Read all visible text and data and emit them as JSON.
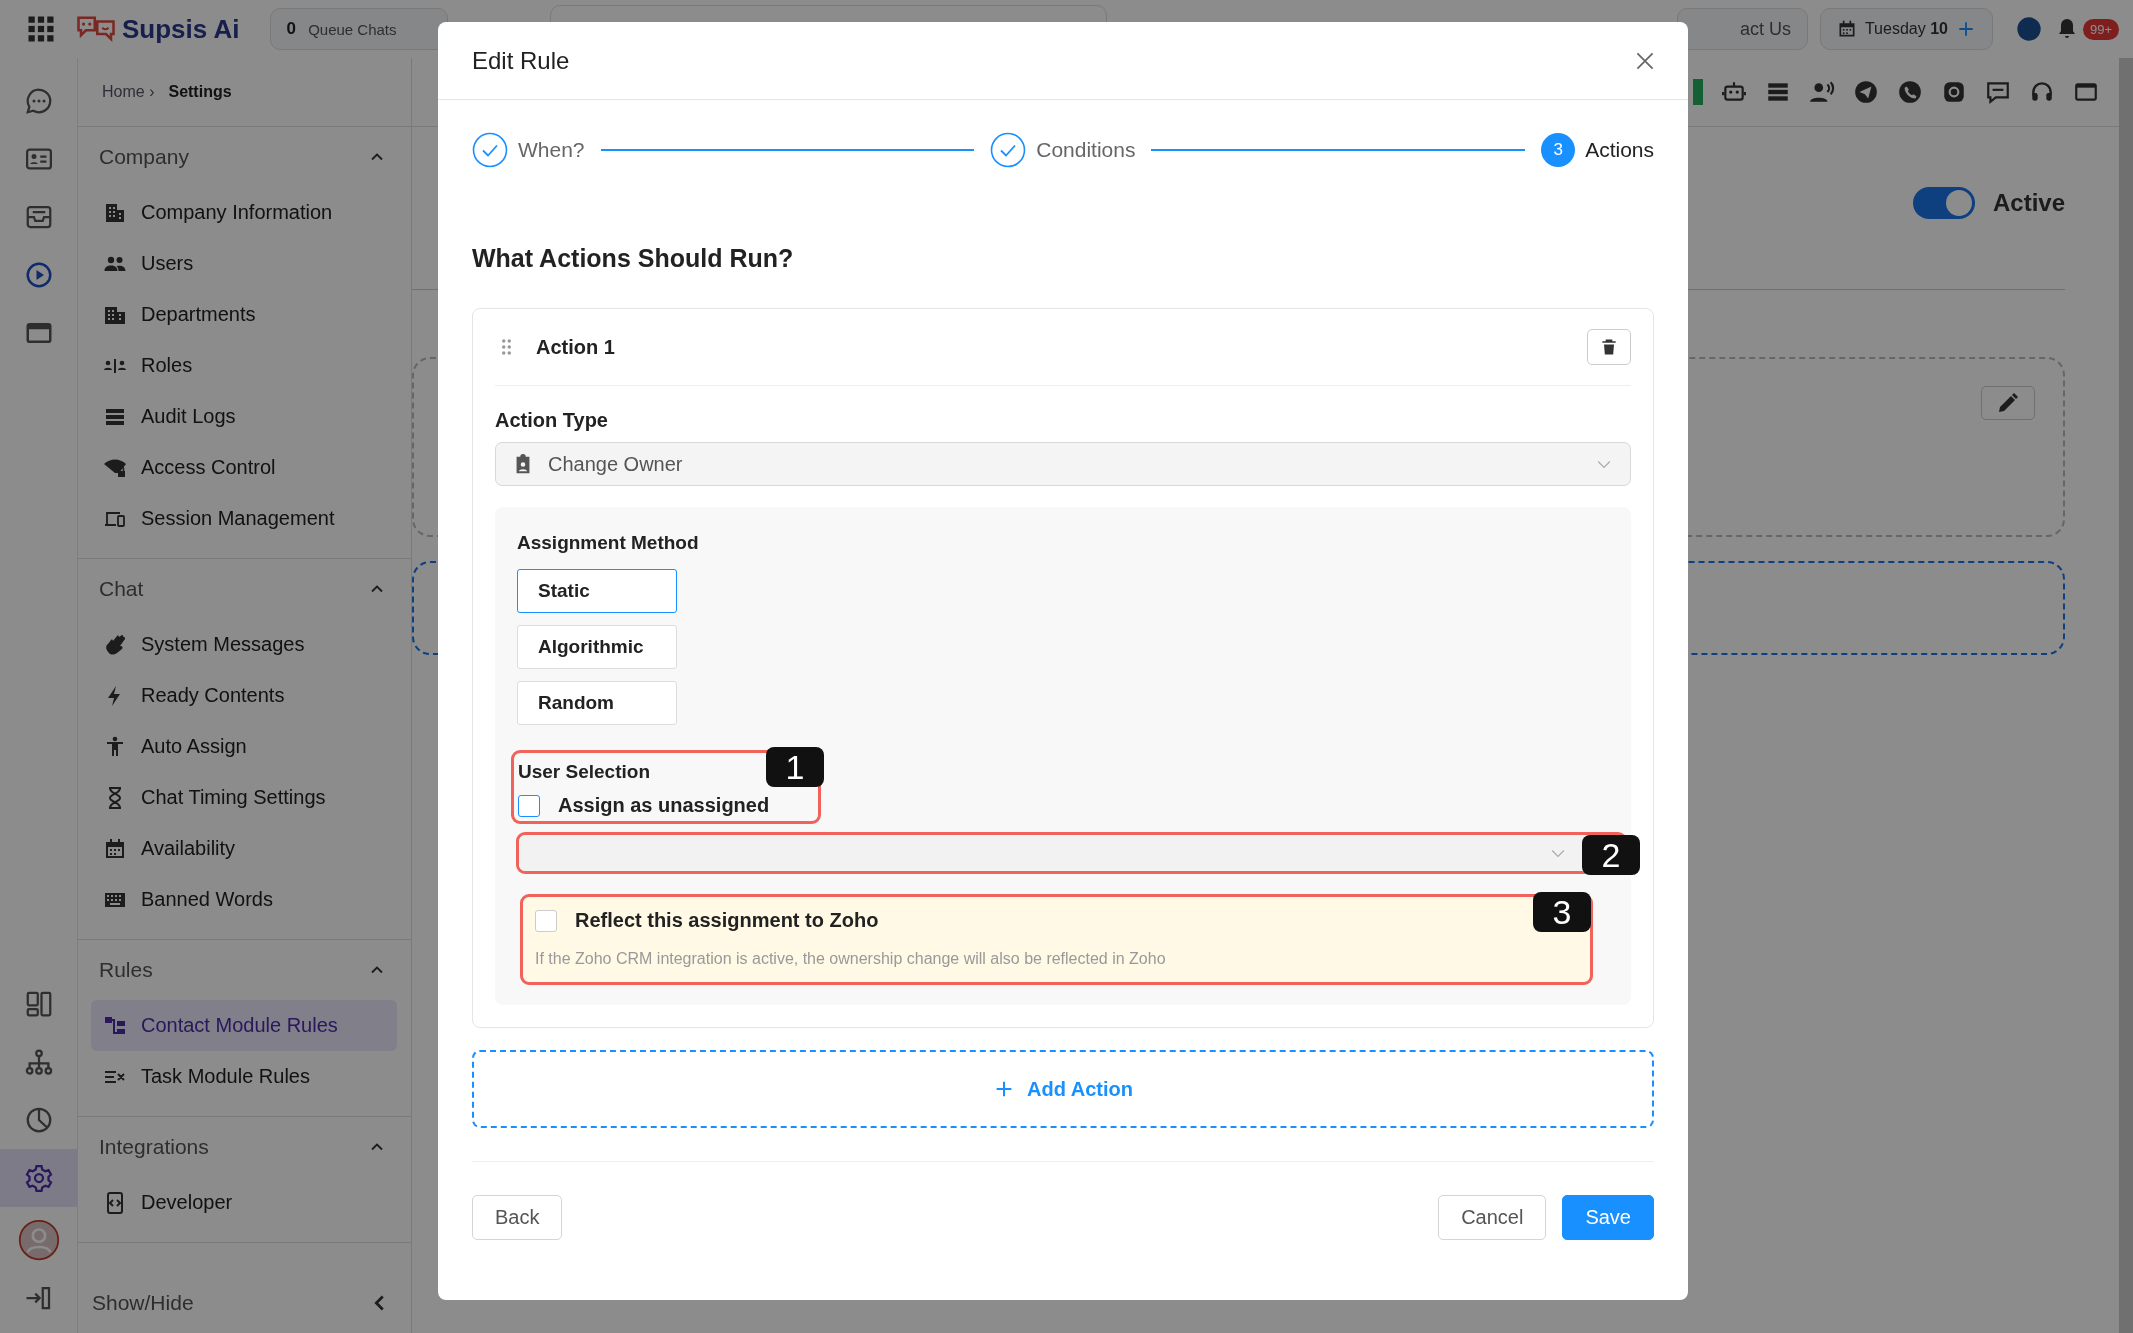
{
  "top_bar": {
    "logo": "Supsis Ai",
    "queue": {
      "count": "0",
      "label": "Queue Chats"
    },
    "contact_link": "act Us",
    "date": {
      "day": "Tuesday",
      "number": "10"
    },
    "notifications": "99+"
  },
  "rail": [
    {
      "kind": "chat",
      "selected": false
    },
    {
      "kind": "contact-card",
      "selected": false
    },
    {
      "kind": "tray",
      "selected": false
    },
    {
      "kind": "play",
      "selected": false
    },
    {
      "kind": "window",
      "selected": false
    },
    {
      "kind": "dashboard",
      "selected": false
    },
    {
      "kind": "hierarchy",
      "selected": false
    },
    {
      "kind": "pie",
      "selected": false
    },
    {
      "kind": "gear",
      "selected": true
    }
  ],
  "breadcrumb": {
    "items": [
      "Home",
      "Settings"
    ],
    "separator": "›"
  },
  "sidebar": {
    "sections": [
      {
        "title": "Company",
        "expanded": true,
        "items": [
          {
            "label": "Company Information",
            "kind": "building",
            "selected": false
          },
          {
            "label": "Users",
            "kind": "people",
            "selected": false
          },
          {
            "label": "Departments",
            "kind": "office",
            "selected": false
          },
          {
            "label": "Roles",
            "kind": "roles",
            "selected": false
          },
          {
            "label": "Audit Logs",
            "kind": "list",
            "selected": false
          },
          {
            "label": "Access Control",
            "kind": "wifi-lock",
            "selected": false
          },
          {
            "label": "Session Management",
            "kind": "devices",
            "selected": false
          }
        ]
      },
      {
        "title": "Chat",
        "expanded": true,
        "items": [
          {
            "label": "System Messages",
            "kind": "hand",
            "selected": false
          },
          {
            "label": "Ready Contents",
            "kind": "lightning",
            "selected": false
          },
          {
            "label": "Auto Assign",
            "kind": "person",
            "selected": false
          },
          {
            "label": "Chat Timing Settings",
            "kind": "hourglass",
            "selected": false
          },
          {
            "label": "Availability",
            "kind": "calendar",
            "selected": false
          },
          {
            "label": "Banned Words",
            "kind": "keyboard",
            "selected": false
          }
        ]
      },
      {
        "title": "Rules",
        "expanded": true,
        "items": [
          {
            "label": "Contact Module Rules",
            "kind": "flowchart",
            "selected": true
          },
          {
            "label": "Task Module Rules",
            "kind": "checklist",
            "selected": false
          }
        ]
      },
      {
        "title": "Integrations",
        "expanded": true,
        "items": [
          {
            "label": "Developer",
            "kind": "code",
            "selected": false
          }
        ]
      }
    ],
    "footer": "Show/Hide"
  },
  "background": {
    "toggle": {
      "label": "Active",
      "on": true
    }
  },
  "modal": {
    "title": "Edit Rule",
    "steps": [
      {
        "label": "When?",
        "completed": true
      },
      {
        "label": "Conditions",
        "completed": true
      },
      {
        "number": "3",
        "label": "Actions",
        "completed": false
      }
    ],
    "heading": "What Actions Should Run?",
    "actions": [
      {
        "title": "Action 1",
        "type_label": "Action Type",
        "type_value": "Change Owner",
        "method_label": "Assignment Method",
        "methods": [
          {
            "label": "Static",
            "selected": true
          },
          {
            "label": "Algorithmic",
            "selected": false
          },
          {
            "label": "Random",
            "selected": false
          }
        ],
        "user_selection": {
          "label": "User Selection",
          "checkbox": {
            "label": "Assign as unassigned",
            "checked": false
          }
        },
        "zoho": {
          "label": "Reflect this assignment to Zoho",
          "checked": false,
          "hint": "If the Zoho CRM integration is active, the ownership change will also be reflected in Zoho"
        }
      }
    ],
    "add_action": "Add Action",
    "back": "Back",
    "cancel": "Cancel",
    "save": "Save"
  },
  "annotations": [
    {
      "number": "1"
    },
    {
      "number": "2"
    },
    {
      "number": "3"
    }
  ]
}
